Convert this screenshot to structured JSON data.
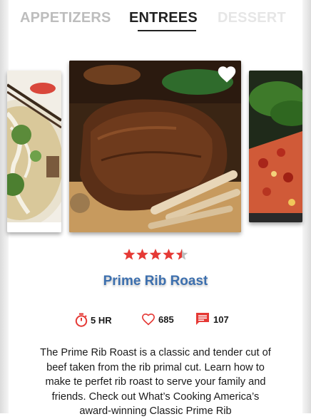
{
  "tabs": {
    "left": "APPETIZERS",
    "active": "ENTREES",
    "right": "DESSERT"
  },
  "carousel": {
    "items": [
      {
        "image": "noodle-soup-photo"
      },
      {
        "image": "prime-rib-roast-photo",
        "favorited": true
      },
      {
        "image": "pizza-photo"
      }
    ]
  },
  "recipe": {
    "rating": 4.5,
    "rating_max": 5,
    "title": "Prime Rib Roast",
    "time": "5 HR",
    "likes": "685",
    "comments": "107",
    "description": "The Prime Rib Roast is a classic and tender cut of beef taken from the rib primal cut. Learn how to make te perfet rib roast to serve your family and friends. Check out What’s Cooking America’s award-winning Classic Prime Rib"
  },
  "colors": {
    "accent_red": "#e53935",
    "title_blue": "#3c6fae",
    "text": "#1a1a1a"
  }
}
